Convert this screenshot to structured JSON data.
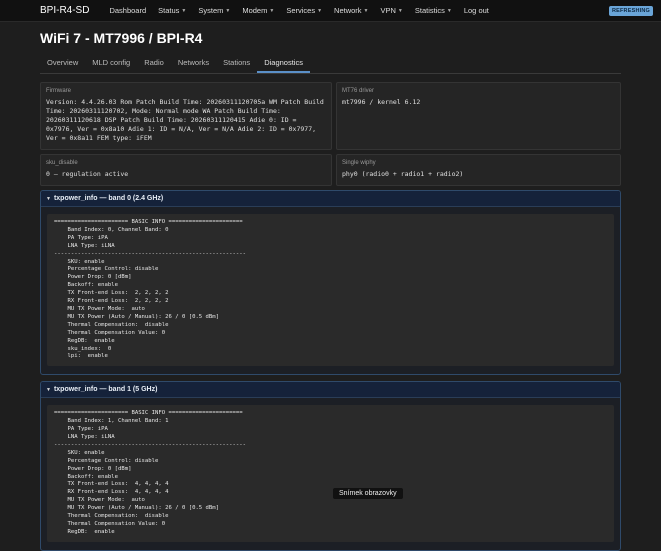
{
  "navbar": {
    "brand": "BPI-R4-SD",
    "items": [
      {
        "label": "Dashboard",
        "caret": false
      },
      {
        "label": "Status",
        "caret": true
      },
      {
        "label": "System",
        "caret": true
      },
      {
        "label": "Modem",
        "caret": true
      },
      {
        "label": "Services",
        "caret": true
      },
      {
        "label": "Network",
        "caret": true
      },
      {
        "label": "VPN",
        "caret": true
      },
      {
        "label": "Statistics",
        "caret": true
      },
      {
        "label": "Log out",
        "caret": false
      }
    ],
    "badge": "REFRESHING"
  },
  "page": {
    "title": "WiFi 7 - MT7996 / BPI-R4",
    "tabs": [
      "Overview",
      "MLD config",
      "Radio",
      "Networks",
      "Stations",
      "Diagnostics"
    ],
    "active_tab": "Diagnostics"
  },
  "info": {
    "firmware_label": "Firmware",
    "firmware_value": "Version: 4.4.26.03 Rom Patch Build Time: 20260311120705a WM Patch Build Time: 20260311120702, Mode: Normal mode WA Patch Build Time: 20260311120618 DSP Patch Build Time: 20260311120415 Adie 0: ID = 0x7976, Ver = 0x8a10 Adie 1: ID = N/A, Ver = N/A Adie 2: ID = 0x7977, Ver = 0x8a11 FEM type: iFEM",
    "driver_label": "MT76 driver",
    "driver_value": "mt7996 / kernel 6.12",
    "sku_label": "sku_disable",
    "sku_value": "0 — regulation active",
    "wiphy_label": "Single wiphy",
    "wiphy_value": "phy0 (radio0 + radio1 + radio2)"
  },
  "sections": [
    {
      "title": "txpower_info — band 0 (2.4 GHz)",
      "pre": "====================== BASIC INFO ======================\n    Band Index: 0, Channel Band: 0\n    PA Type: iPA\n    LNA Type: iLNA\n---------------------------------------------------------\n    SKU: enable\n    Percentage Control: disable\n    Power Drop: 0 [dBm]\n    Backoff: enable\n    TX Front-end Loss:  2, 2, 2, 2\n    RX Front-end Loss:  2, 2, 2, 2\n    MU TX Power Mode:  auto\n    MU TX Power (Auto / Manual): 26 / 0 [0.5 dBm]\n    Thermal Compensation:  disable\n    Thermal Compensation Value: 0\n    RegDB:  enable\n    sku_index:  0\n    lpi:  enable"
    },
    {
      "title": "txpower_info — band 1 (5 GHz)",
      "pre": "====================== BASIC INFO ======================\n    Band Index: 1, Channel Band: 1\n    PA Type: iPA\n    LNA Type: iLNA\n---------------------------------------------------------\n    SKU: enable\n    Percentage Control: disable\n    Power Drop: 0 [dBm]\n    Backoff: enable\n    TX Front-end Loss:  4, 4, 4, 4\n    RX Front-end Loss:  4, 4, 4, 4\n    MU TX Power Mode:  auto\n    MU TX Power (Auto / Manual): 26 / 0 [0.5 dBm]\n    Thermal Compensation:  disable\n    Thermal Compensation Value: 0\n    RegDB:  enable"
    }
  ],
  "toast": "Snímek obrazovky"
}
